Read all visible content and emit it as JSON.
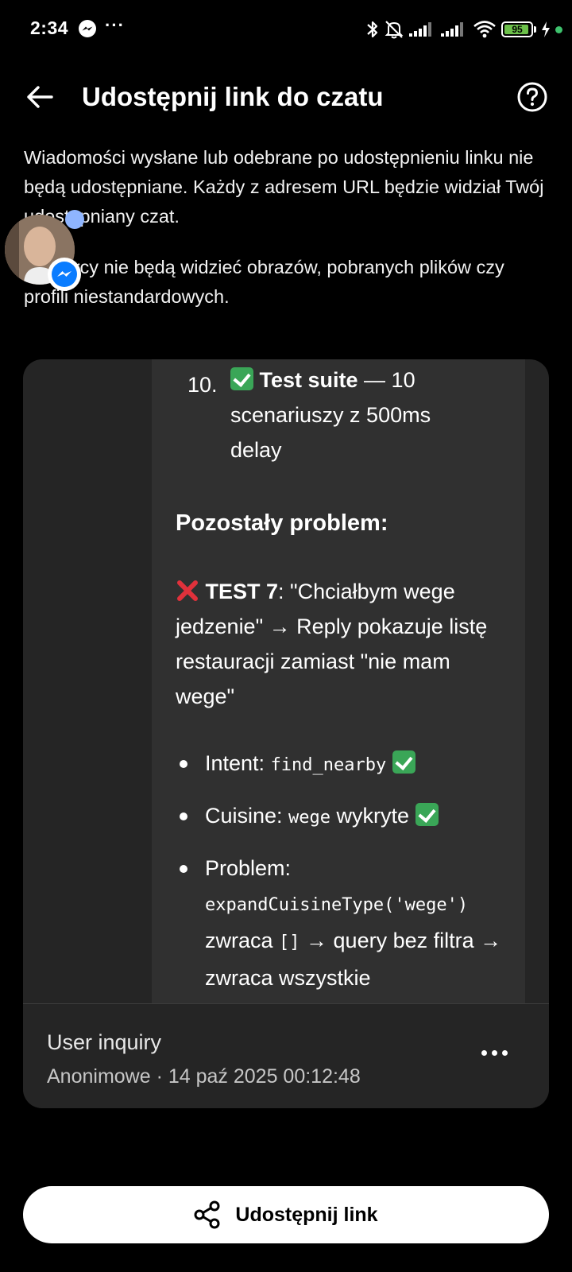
{
  "status_bar": {
    "time": "2:34",
    "more": "···",
    "battery": "95",
    "icons": [
      "messenger-icon",
      "bluetooth-icon",
      "bell-off-icon",
      "signal-icon",
      "signal-icon",
      "wifi-icon",
      "battery-icon",
      "charging-icon"
    ]
  },
  "header": {
    "title": "Udostępnij link do czatu",
    "back_icon": "arrow-left-icon",
    "help_icon": "question-circle-icon"
  },
  "description": {
    "para1": "Wiadomości wysłane lub odebrane po udostępnieniu linku nie będą udostępniane. Każdy z adresem URL będzie widział Twój udostępniany czat.",
    "para2": "Odbiorcy nie będą widzieć obrazów, pobranych plików czy profili niestandardowych."
  },
  "preview": {
    "item10_num": "10.",
    "item10_title": "Test suite",
    "item10_rest": " — 10 scenariuszy z 500ms delay",
    "heading": "Pozostały problem:",
    "test_label": "TEST 7",
    "test_text": ": \"Chciałbym wege jedzenie\" → Reply pokazuje listę restauracji zamiast \"nie mam wege\"",
    "b1_label": "Intent: ",
    "b1_code": "find_nearby",
    "b2_label": "Cuisine: ",
    "b2_code": "wege",
    "b2_after": " wykryte",
    "b3_label": "Problem:",
    "b3_code": "expandCuisineType('wege')",
    "b3_mid": " zwraca ",
    "b3_code2": "[]",
    "b3_after": " → query bez filtra → zwraca wszystkie"
  },
  "card_footer": {
    "title": "User inquiry",
    "meta": "Anonimowe · 14 paź 2025 00:12:48"
  },
  "share_button": {
    "label": "Udostępnij link",
    "icon": "share-icon"
  },
  "colors": {
    "background": "#000000",
    "card": "#252525",
    "card_content": "#303030",
    "accent_blue": "#0a7cff",
    "check_green": "#3aa657",
    "cross_red": "#e0313b"
  }
}
